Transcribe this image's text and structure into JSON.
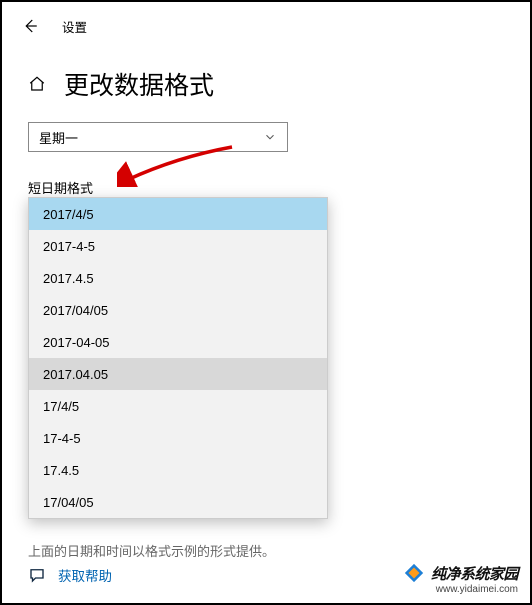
{
  "header": {
    "title": "设置"
  },
  "page": {
    "title": "更改数据格式"
  },
  "combobox": {
    "value": "星期一"
  },
  "section": {
    "label": "短日期格式"
  },
  "dropdown": {
    "items": [
      {
        "label": "2017/4/5",
        "state": "selected"
      },
      {
        "label": "2017-4-5",
        "state": ""
      },
      {
        "label": "2017.4.5",
        "state": ""
      },
      {
        "label": "2017/04/05",
        "state": ""
      },
      {
        "label": "2017-04-05",
        "state": ""
      },
      {
        "label": "2017.04.05",
        "state": "hovered"
      },
      {
        "label": "17/4/5",
        "state": ""
      },
      {
        "label": "17-4-5",
        "state": ""
      },
      {
        "label": "17.4.5",
        "state": ""
      },
      {
        "label": "17/04/05",
        "state": ""
      }
    ]
  },
  "hint": "上面的日期和时间以格式示例的形式提供。",
  "help": {
    "label": "获取帮助"
  },
  "watermark": {
    "brand": "纯净系统家园",
    "url": "www.yidaimei.com"
  }
}
